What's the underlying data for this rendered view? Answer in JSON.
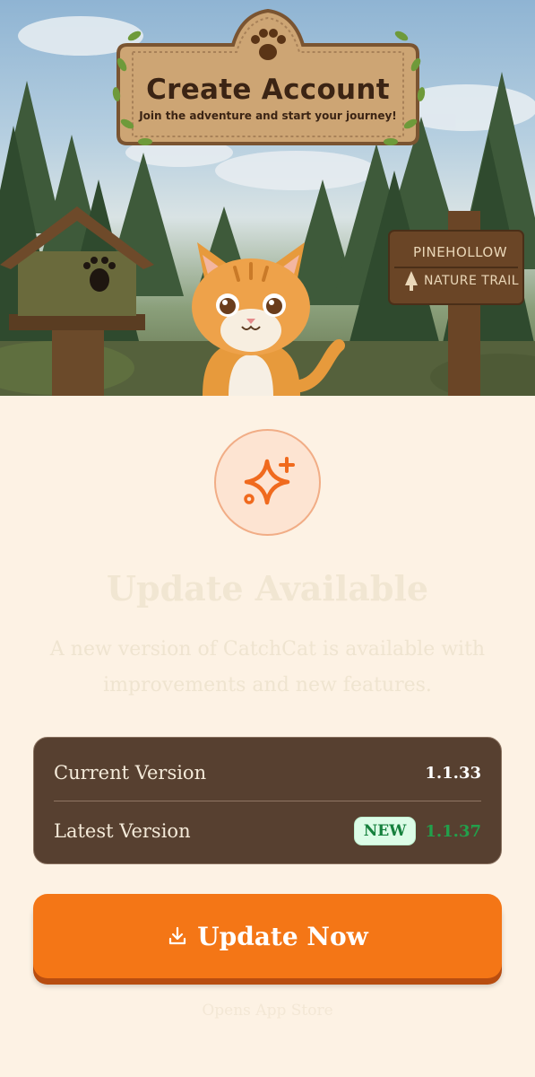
{
  "hero": {
    "title": "Create Account",
    "subtitle": "Join the adventure and start your journey!",
    "sign_line1": "PINEHOLLOW",
    "sign_line2": "NATURE TRAIL"
  },
  "dialog": {
    "icon": "sparkle-icon",
    "title": "Update Available",
    "description": "A new version of CatchCat is available with improvements and new features.",
    "current_label": "Current Version",
    "current_value": "1.1.33",
    "latest_label": "Latest Version",
    "latest_badge": "NEW",
    "latest_value": "1.1.37",
    "button_label": "Update Now",
    "button_icon": "download-icon",
    "footnote": "Opens App Store"
  },
  "colors": {
    "accent": "#f47616",
    "card": "#574030",
    "background": "#fdf2e4",
    "new_badge_text": "#15803d"
  }
}
